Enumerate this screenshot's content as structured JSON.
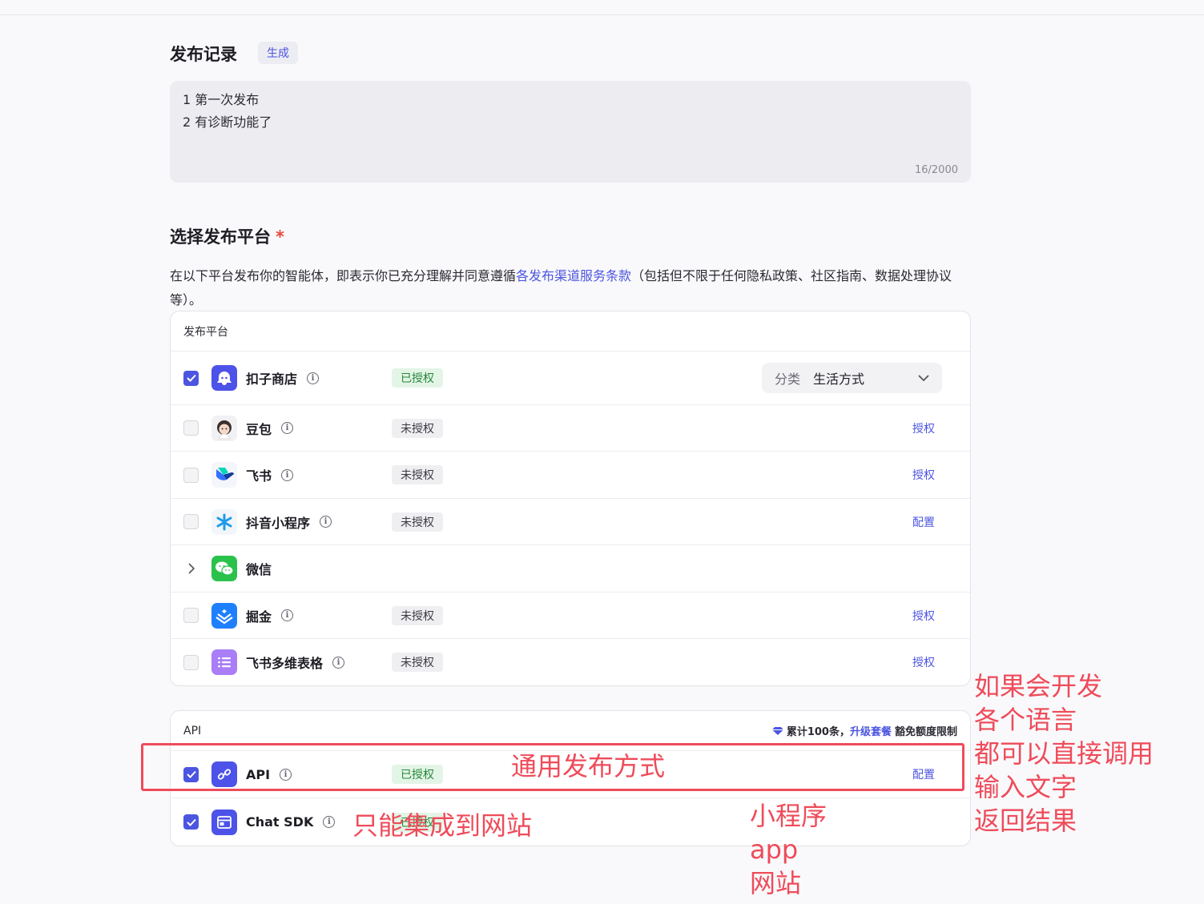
{
  "release": {
    "title": "发布记录",
    "generate_label": "生成",
    "notes": [
      "1 第一次发布",
      "2 有诊断功能了"
    ],
    "counter": "16/2000"
  },
  "platform_section": {
    "title": "选择发布平台",
    "required_mark": "*",
    "desc_before": "在以下平台发布你的智能体，即表示你已充分理解并同意遵循",
    "desc_link": "各发布渠道服务条款",
    "desc_after": "（包括但不限于任何隐私政策、社区指南、数据处理协议等）。"
  },
  "platforms": {
    "header": "发布平台",
    "rows": [
      {
        "name": "扣子商店",
        "checked": true,
        "badge": "已授权",
        "category_label": "分类",
        "category_value": "生活方式"
      },
      {
        "name": "豆包",
        "checked": false,
        "badge": "未授权",
        "action": "授权"
      },
      {
        "name": "飞书",
        "checked": false,
        "badge": "未授权",
        "action": "授权"
      },
      {
        "name": "抖音小程序",
        "checked": false,
        "badge": "未授权",
        "action": "配置"
      },
      {
        "name": "微信"
      },
      {
        "name": "掘金",
        "checked": false,
        "badge": "未授权",
        "action": "授权"
      },
      {
        "name": "飞书多维表格",
        "checked": false,
        "badge": "未授权",
        "action": "授权"
      }
    ]
  },
  "api": {
    "header": "API",
    "quota_before": "累计100条，",
    "quota_link": "升级套餐",
    "quota_after": "豁免额度限制",
    "rows": [
      {
        "name": "API",
        "checked": true,
        "badge": "已授权",
        "action": "配置"
      },
      {
        "name": "Chat SDK",
        "checked": true,
        "badge": "已授权"
      }
    ]
  },
  "annotations": {
    "api_note": "通用发布方式",
    "sdk_note": "只能集成到网站",
    "targets": [
      "小程序",
      "app",
      "网站"
    ],
    "right_note": [
      "如果会开发",
      "各个语言",
      "都可以直接调用",
      "输入文字",
      "返回结果"
    ]
  },
  "colors": {
    "accent": "#4c55e0",
    "annotation": "#ef4b5a",
    "authorized_bg": "#e3f5e6",
    "authorized_text": "#25873a"
  }
}
